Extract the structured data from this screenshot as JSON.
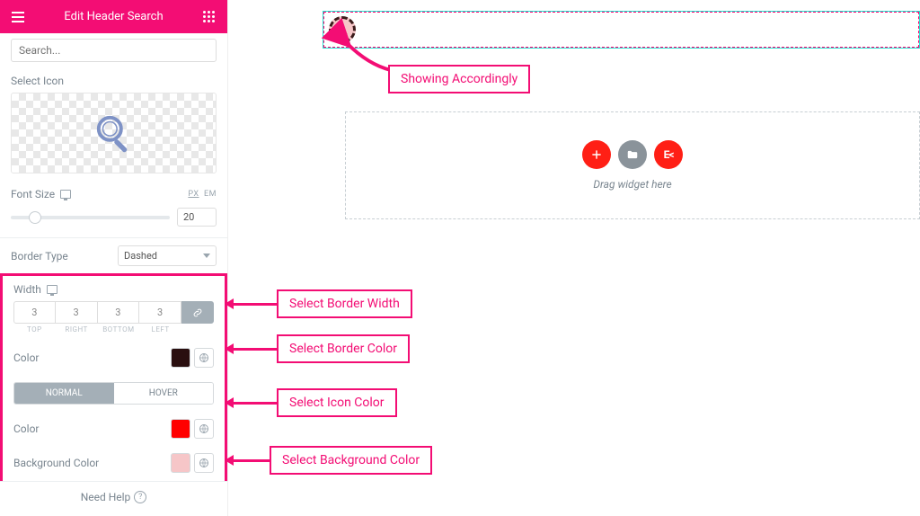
{
  "header": {
    "title": "Edit Header Search"
  },
  "search": {
    "placeholder": "Search..."
  },
  "select_icon": {
    "label": "Select Icon"
  },
  "font_size": {
    "label": "Font Size",
    "value": "20",
    "unit_px": "PX",
    "unit_em": "EM"
  },
  "border_type": {
    "label": "Border Type",
    "value": "Dashed"
  },
  "width": {
    "label": "Width",
    "top": "3",
    "right": "3",
    "bottom": "3",
    "left": "3",
    "lbl_top": "TOP",
    "lbl_right": "RIGHT",
    "lbl_bottom": "BOTTOM",
    "lbl_left": "LEFT"
  },
  "border_color": {
    "label": "Color",
    "value": "#2a0f0f"
  },
  "tabs": {
    "normal": "NORMAL",
    "hover": "HOVER"
  },
  "icon_color": {
    "label": "Color",
    "value": "#ff0000"
  },
  "bg_color": {
    "label": "Background Color",
    "value": "#f6c6c8"
  },
  "need_help": "Need Help",
  "dropzone": {
    "label": "Drag widget here",
    "ek": "E<"
  },
  "callouts": {
    "showing": "Showing Accordingly",
    "border_width": "Select Border Width",
    "border_color": "Select Border Color",
    "icon_color": "Select Icon Color",
    "bg_color": "Select Background Color"
  },
  "colors": {
    "accent": "#F30D74",
    "border_swatch": "#2a0f0f",
    "icon_swatch": "#ff0000",
    "bg_swatch": "#f6c6c8"
  }
}
